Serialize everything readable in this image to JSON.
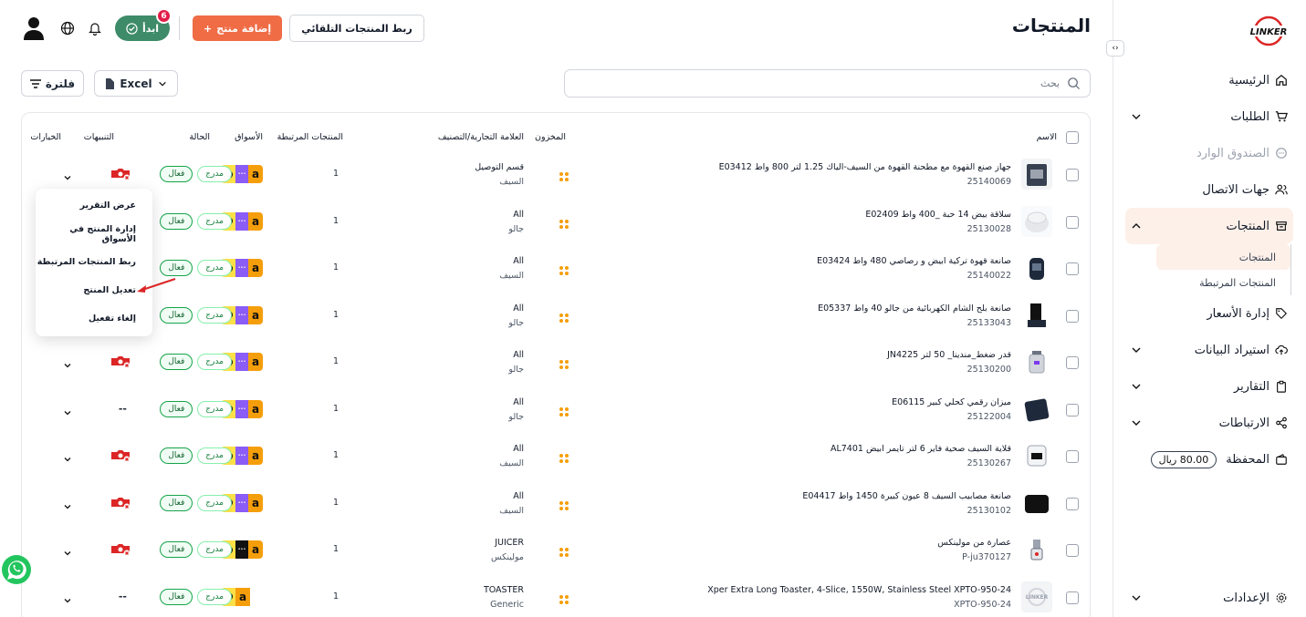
{
  "brand": {
    "logo_text": "LINKER"
  },
  "sidebar": {
    "items": [
      {
        "label": "الرئيسية",
        "icon": "home-icon"
      },
      {
        "label": "الطلبات",
        "icon": "cart-icon"
      },
      {
        "label": "الصندوق الوارد",
        "icon": "chat-icon"
      },
      {
        "label": "جهات الاتصال",
        "icon": "users-icon"
      },
      {
        "label": "المنتجات",
        "icon": "box-icon"
      },
      {
        "label": "إدارة الأسعار",
        "icon": "tag-icon"
      },
      {
        "label": "استيراد البيانات",
        "icon": "cloud-upload-icon"
      },
      {
        "label": "التقارير",
        "icon": "clipboard-icon"
      },
      {
        "label": "الارتباطات",
        "icon": "share-icon"
      },
      {
        "label": "المحفظة",
        "icon": "wallet-icon"
      },
      {
        "label": "الإعدادات",
        "icon": "gear-icon"
      }
    ],
    "products_sub": [
      "المنتجات",
      "المنتجات المرتبطة"
    ],
    "wallet_balance": "80.00 ريال"
  },
  "header": {
    "title": "المنتجات",
    "start_label": "ابدأ",
    "start_badge": "6",
    "add_product_label": "إضافة منتج",
    "auto_link_label": "ربط المنتجات التلقائي"
  },
  "toolbar": {
    "search_placeholder": "بحث",
    "excel_label": "Excel",
    "filter_label": "فلترة"
  },
  "table": {
    "columns": {
      "name": "الاسم",
      "stock": "المخزون",
      "brand": "العلامة التجارية/التصنيف",
      "linked": "المنتجات المرتبطة",
      "markets": "الأسواق",
      "status": "الحالة",
      "alerts": "التنبيهات",
      "options": "الخيارات"
    },
    "status_active": "فعال",
    "status_listed": "مدرج",
    "rows": [
      {
        "name": "جهاز صنع القهوة مع مطحنة القهوة من السيف-الياك 1.25 لتر 800 واط E03412",
        "sku": "25140069",
        "cat1": "قسم التوصيل",
        "cat2": "السيف",
        "linked": "1",
        "alert": "x",
        "img": "coffee"
      },
      {
        "name": "سلاقة بيض 14 حبة _400 واط E02409",
        "sku": "25130028",
        "cat1": "All",
        "cat2": "جالو",
        "linked": "1",
        "alert": "x",
        "img": "egg"
      },
      {
        "name": "صانعة قهوة تركية ابيض و رصاصي 480 واط E03424",
        "sku": "25140022",
        "cat1": "All",
        "cat2": "السيف",
        "linked": "1",
        "alert": "x",
        "img": "turkish"
      },
      {
        "name": "صانعة بلح الشام الكهربائية من جالو 40 واط E05337",
        "sku": "25133043",
        "cat1": "All",
        "cat2": "جالو",
        "linked": "1",
        "alert": "x",
        "img": "maker"
      },
      {
        "name": "قدر ضغط_مندينا_ 50 لتر JN4225",
        "sku": "25130200",
        "cat1": "All",
        "cat2": "جالو",
        "linked": "1",
        "alert": "x",
        "img": "pot"
      },
      {
        "name": "ميزان رقمي كحلي كبير E06115",
        "sku": "25122004",
        "cat1": "All",
        "cat2": "جالو",
        "linked": "1",
        "alert": "--",
        "img": "scale"
      },
      {
        "name": "قلاية السيف صحية فاير 6 لتر تايمر ابيض AL7401",
        "sku": "25130267",
        "cat1": "All",
        "cat2": "السيف",
        "linked": "1",
        "alert": "x",
        "img": "fryer"
      },
      {
        "name": "صانعة مصابيب السيف 8 عيون كبيرة 1450 واط E04417",
        "sku": "25130102",
        "cat1": "All",
        "cat2": "السيف",
        "linked": "1",
        "alert": "x",
        "img": "pan"
      },
      {
        "name": "عصارة من مولينكس",
        "sku": "P-ju370127",
        "cat1": "JUICER",
        "cat2": "مولينكس",
        "linked": "1",
        "alert": "x",
        "img": "juicer",
        "dark_market": true
      },
      {
        "name": "Xper Extra Long Toaster, 4-Slice, 1550W, Stainless Steel XPTO-950-24",
        "sku": "XPTO-950-24",
        "cat1": "TOASTER",
        "cat2": "Generic",
        "linked": "1",
        "alert": "--",
        "img": "linker",
        "two_markets": true
      }
    ]
  },
  "row_menu": {
    "items": [
      "عرض التقرير",
      "إدارة المنتج في الأسواق",
      "ربط المنتجات المرتبطة",
      "تعديل المنتج",
      "إلغاء تفعيل"
    ]
  },
  "colors": {
    "accent": "#ef6c45",
    "start": "#3d8b68",
    "active_bg": "#fdf0e9"
  }
}
